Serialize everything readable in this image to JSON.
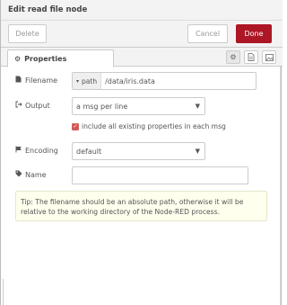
{
  "header": {
    "title": "Edit read file node"
  },
  "buttons": {
    "delete": "Delete",
    "cancel": "Cancel",
    "done": "Done"
  },
  "tabs": {
    "properties": "Properties"
  },
  "form": {
    "filename": {
      "label": "Filename",
      "type": "path",
      "value": "/data/iris.data"
    },
    "output": {
      "label": "Output",
      "value": "a msg per line"
    },
    "include_props": {
      "label": "include all existing properties in each msg",
      "checked": true
    },
    "encoding": {
      "label": "Encoding",
      "value": "default"
    },
    "name": {
      "label": "Name",
      "value": ""
    }
  },
  "tip": "Tip: The filename should be an absolute path, otherwise it will be relative to the working directory of the Node-RED process.",
  "colors": {
    "accent": "#ad1625",
    "tip_bg": "#ffffee"
  },
  "icons": {
    "properties": "gear-icon",
    "description": "file-text-icon",
    "appearance": "picture-icon",
    "filename": "file-icon",
    "output": "sign-out-icon",
    "encoding": "flag-icon",
    "name": "tag-icon"
  }
}
